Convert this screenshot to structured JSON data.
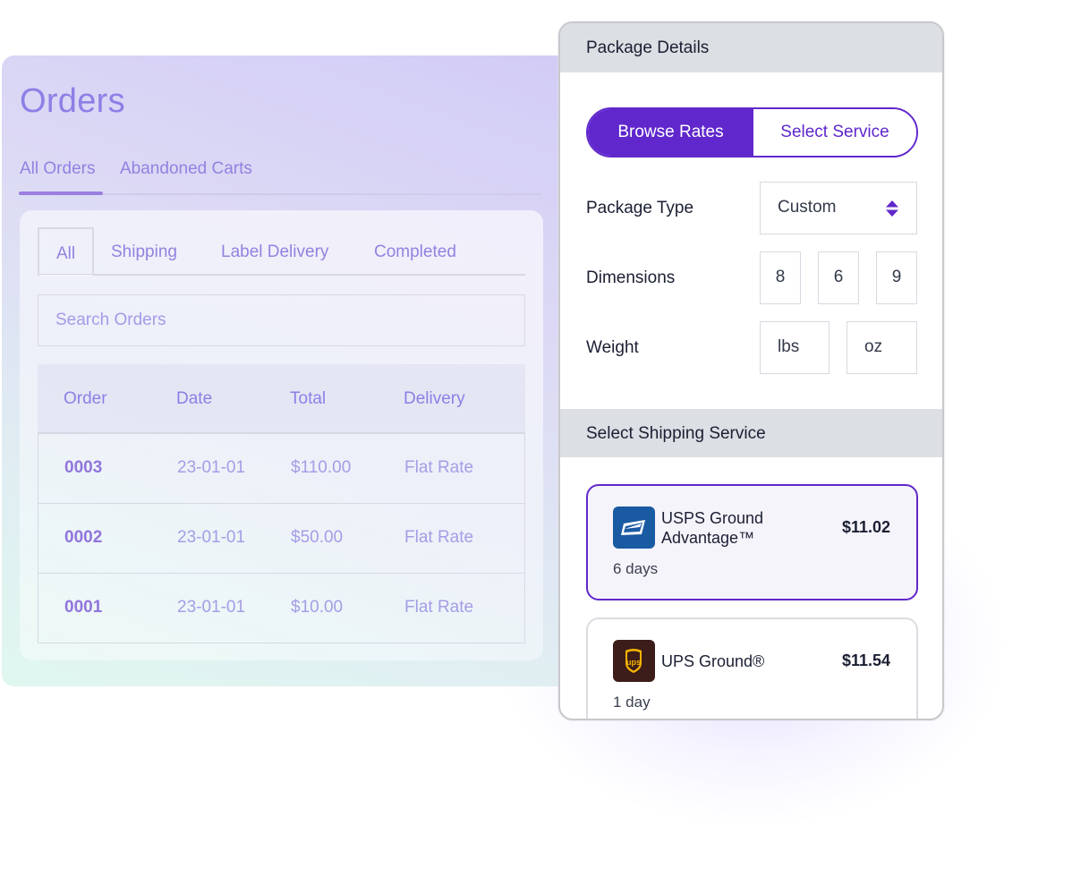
{
  "orders": {
    "title": "Orders",
    "top_tabs": [
      {
        "label": "All Orders",
        "active": true
      },
      {
        "label": "Abandoned Carts",
        "active": false
      }
    ],
    "filter_tabs": [
      {
        "label": "All",
        "active": true
      },
      {
        "label": "Shipping",
        "active": false
      },
      {
        "label": "Label Delivery",
        "active": false
      },
      {
        "label": "Completed",
        "active": false
      }
    ],
    "search": {
      "placeholder": "Search Orders",
      "value": ""
    },
    "table": {
      "columns": [
        "Order",
        "Date",
        "Total",
        "Delivery"
      ],
      "rows": [
        {
          "order": "0003",
          "date": "23-01-01",
          "total": "$110.00",
          "delivery": "Flat Rate"
        },
        {
          "order": "0002",
          "date": "23-01-01",
          "total": "$50.00",
          "delivery": "Flat Rate"
        },
        {
          "order": "0001",
          "date": "23-01-01",
          "total": "$10.00",
          "delivery": "Flat Rate"
        }
      ]
    }
  },
  "package": {
    "header": "Package Details",
    "segment": {
      "options": [
        {
          "label": "Browse Rates",
          "active": true
        },
        {
          "label": "Select Service",
          "active": false
        }
      ]
    },
    "package_type": {
      "label": "Package Type",
      "value": "Custom",
      "icon": "updown-arrows-icon"
    },
    "dimensions": {
      "label": "Dimensions",
      "values": [
        "8",
        "6",
        "9"
      ]
    },
    "weight": {
      "label": "Weight",
      "lbs_placeholder": "lbs",
      "oz_placeholder": "oz"
    },
    "shipping_header": "Select Shipping Service",
    "services": [
      {
        "carrier": "USPS",
        "icon": "usps-eagle-logo-icon",
        "name_line1": "USPS Ground",
        "name_line2": "Advantage™",
        "price": "$11.02",
        "days": "6 days",
        "selected": true
      },
      {
        "carrier": "UPS",
        "icon": "ups-shield-logo-icon",
        "name_line1": "UPS Ground®",
        "name_line2": "",
        "price": "$11.54",
        "days": "1 day",
        "selected": false
      }
    ]
  },
  "colors": {
    "accent_purple": "#5f27cc",
    "orders_text": "#8b80e6",
    "usps_blue": "#1a5aa3",
    "ups_brown": "#3c1d1a",
    "ups_gold": "#f4b400"
  }
}
